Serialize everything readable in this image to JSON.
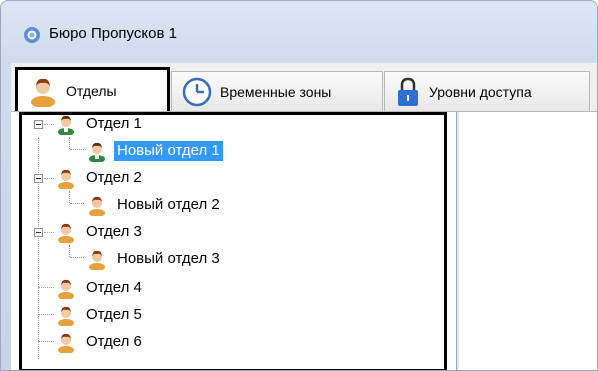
{
  "window": {
    "title": "Бюро Пропусков 1"
  },
  "tabs": [
    {
      "label": "Отделы",
      "icon": "person-icon",
      "active": true
    },
    {
      "label": "Временные зоны",
      "icon": "clock-icon",
      "active": false
    },
    {
      "label": "Уровни доступа",
      "icon": "lock-icon",
      "active": false
    }
  ],
  "tree": {
    "nodes": [
      {
        "label": "Отдел 1",
        "level": 0,
        "expanded": true,
        "icon": "user-green-icon"
      },
      {
        "label": "Новый отдел 1",
        "level": 1,
        "selected": true,
        "icon": "user-green-icon"
      },
      {
        "label": "Отдел 2",
        "level": 0,
        "expanded": true,
        "icon": "user-icon"
      },
      {
        "label": "Новый отдел 2",
        "level": 1,
        "icon": "user-icon"
      },
      {
        "label": "Отдел 3",
        "level": 0,
        "expanded": true,
        "icon": "user-icon"
      },
      {
        "label": "Новый отдел 3",
        "level": 1,
        "icon": "user-icon"
      },
      {
        "label": "Отдел 4",
        "level": 0,
        "icon": "user-icon"
      },
      {
        "label": "Отдел 5",
        "level": 0,
        "icon": "user-icon"
      },
      {
        "label": "Отдел 6",
        "level": 0,
        "icon": "user-icon"
      }
    ]
  },
  "colors": {
    "selection": "#3399ff",
    "tab_border_highlight": "#000000"
  }
}
